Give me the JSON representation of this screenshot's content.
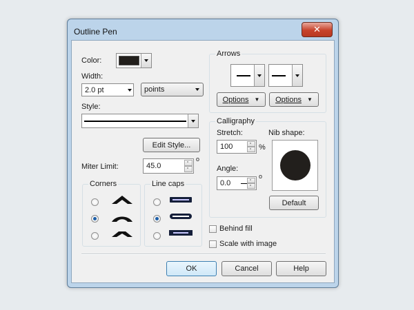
{
  "window": {
    "title": "Outline Pen",
    "close_glyph": "✕"
  },
  "left": {
    "color_label": "Color:",
    "color_value": "#221f1c",
    "width_label": "Width:",
    "width_value": "2.0 pt",
    "units_value": "points",
    "style_label": "Style:",
    "edit_style_label": "Edit Style...",
    "miter_label": "Miter Limit:",
    "miter_value": "45.0",
    "degree_symbol": "o"
  },
  "corners": {
    "title": "Corners",
    "selected_index": 1
  },
  "line_caps": {
    "title": "Line caps",
    "selected_index": 1
  },
  "arrows": {
    "title": "Arrows",
    "options_left_label": "Options",
    "options_right_label": "Options"
  },
  "calligraphy": {
    "title": "Calligraphy",
    "stretch_label": "Stretch:",
    "stretch_value": "100",
    "percent_symbol": "%",
    "nib_label": "Nib shape:",
    "angle_label": "Angle:",
    "angle_value": "0.0",
    "degree_symbol": "o",
    "default_label": "Default"
  },
  "checks": {
    "behind_fill_label": "Behind fill",
    "behind_fill_checked": false,
    "scale_label": "Scale with image",
    "scale_checked": false
  },
  "footer": {
    "ok_label": "OK",
    "cancel_label": "Cancel",
    "help_label": "Help"
  },
  "colors": {
    "accent": "#1d5fa8",
    "title_bar": "#bcd4ea",
    "nib": "#221f1c"
  }
}
